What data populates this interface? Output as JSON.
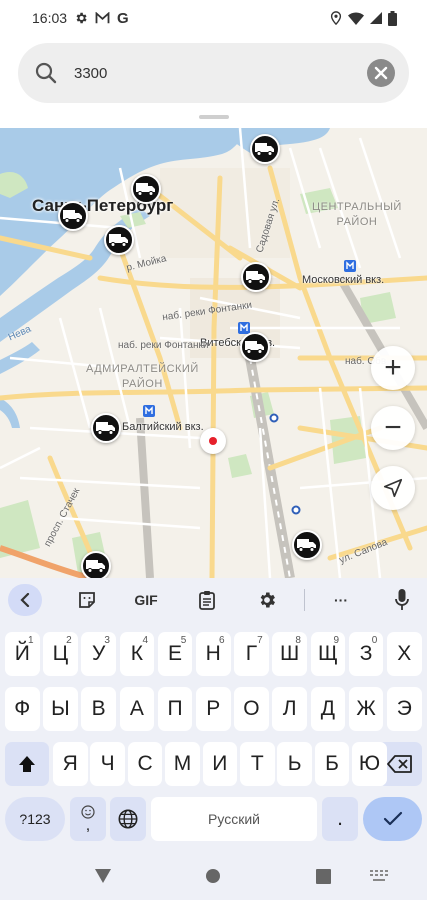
{
  "status_bar": {
    "time": "16:03",
    "icons": [
      "gear-icon",
      "gmail-icon",
      "google-icon",
      "location-icon",
      "wifi-icon",
      "signal-icon",
      "battery-icon"
    ],
    "g_letter": "G"
  },
  "search": {
    "value": "3300",
    "placeholder": ""
  },
  "map": {
    "city_label": "Санкт-Петербург",
    "districts": {
      "central": [
        "ЦЕНТРАЛЬНЫЙ",
        "РАЙОН"
      ],
      "admiralty": [
        "АДМИРАЛТЕЙСКИЙ",
        "РАЙОН"
      ]
    },
    "stations": {
      "moskovsky": "Московский вкз.",
      "vitebsky": "Витебский вкз.",
      "baltiysky": "Балтийский вкз."
    },
    "streets": {
      "moika": "р. Мойка",
      "fontanka": "наб. реки Фонтанки",
      "fontanka2": "наб. реки Фонтанки",
      "sadovaya": "Садовая ул.",
      "stachek": "просп. Стачек",
      "sapova": "ул. Сапова",
      "neva": "Нева",
      "obv": "наб. Обв"
    },
    "marker_count": 10,
    "colors": {
      "water": "#a9cbe8",
      "park": "#cfe7c1",
      "road_major": "#f9d98d",
      "road_minor": "#ffffff",
      "marker": "#111111",
      "location_dot": "#e6202b"
    }
  },
  "map_controls": {
    "zoom_in": "+",
    "zoom_out": "−"
  },
  "keyboard": {
    "toolbar": {
      "gif_label": "GIF",
      "more_label": "···"
    },
    "row1": [
      {
        "key": "Й",
        "hint": "1"
      },
      {
        "key": "Ц",
        "hint": "2"
      },
      {
        "key": "У",
        "hint": "3"
      },
      {
        "key": "К",
        "hint": "4"
      },
      {
        "key": "Е",
        "hint": "5"
      },
      {
        "key": "Н",
        "hint": "6"
      },
      {
        "key": "Г",
        "hint": "7"
      },
      {
        "key": "Ш",
        "hint": "8"
      },
      {
        "key": "Щ",
        "hint": "9"
      },
      {
        "key": "З",
        "hint": "0"
      },
      {
        "key": "Х",
        "hint": ""
      }
    ],
    "row2": [
      "Ф",
      "Ы",
      "В",
      "А",
      "П",
      "Р",
      "О",
      "Л",
      "Д",
      "Ж",
      "Э"
    ],
    "row3": [
      "Я",
      "Ч",
      "С",
      "М",
      "И",
      "Т",
      "Ь",
      "Б",
      "Ю"
    ],
    "symbols_label": "?123",
    "emoji_comma": ",",
    "space_label": "Русский",
    "period_label": "."
  },
  "accent_color": "#aec7f5"
}
